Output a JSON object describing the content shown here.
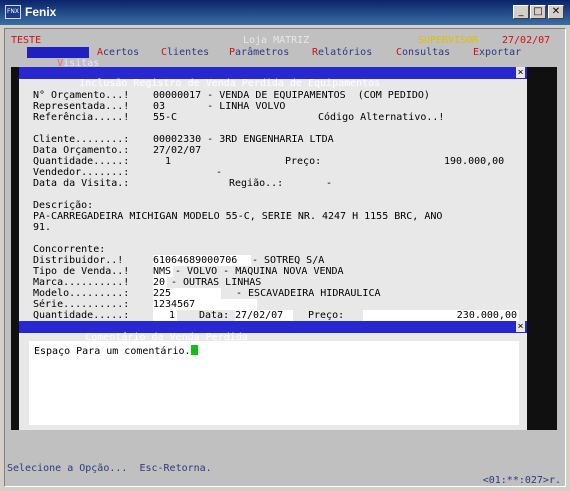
{
  "window": {
    "title": "Fenix",
    "icon": "fenix-logo-icon",
    "min": "_",
    "max": "□",
    "close": "✕"
  },
  "header": {
    "env": "TESTE",
    "store": "Loja MATRIZ",
    "user": "SUPERVISOR",
    "date": "27/02/07"
  },
  "menu": [
    {
      "hk": "V",
      "rest": "isitas",
      "active": true
    },
    {
      "hk": "A",
      "rest": "certos"
    },
    {
      "hk": "C",
      "rest": "lientes"
    },
    {
      "hk": "P",
      "rest": "arâmetros"
    },
    {
      "hk": "R",
      "rest": "elatórios"
    },
    {
      "hk": "C",
      "rest": "onsultas"
    },
    {
      "hk": "E",
      "rest": "xportar"
    }
  ],
  "dialog": {
    "title": "Inclusão Registro de Venda Perdida de Equipamentos",
    "close": "×",
    "orcamento_label": "N° Orçamento...!",
    "orcamento_value": "00000017 - VENDA DE EQUIPAMENTOS  (COM PEDIDO)",
    "representada_label": "Representada...!",
    "representada_value": "03       - LINHA VOLVO",
    "referencia_label": "Referência.....!",
    "referencia_value": "55-C",
    "codigo_alt_label": "Código Alternativo..!",
    "cliente_label": "Cliente........:",
    "cliente_value": "00002330 - 3RD ENGENHARIA LTDA",
    "data_orc_label": "Data Orçamento.:",
    "data_orc_value": "27/02/07",
    "quantidade_label": "Quantidade.....:",
    "quantidade_value": "1",
    "preco_label": "Preço:",
    "preco_value": "190.000,00",
    "vendedor_label": "Vendedor.......:",
    "vendedor_value": "-",
    "data_visita_label": "Data da Visita.:",
    "regiao_label": "Região..:",
    "regiao_value": "-",
    "descricao_label": "Descrição:",
    "descricao_line1": "PA-CARREGADEIRA MICHIGAN MODELO 55-C, SERIE NR. 4247 H 1155 BRC, ANO",
    "descricao_line2": "91.",
    "concorrente_label": "Concorrente:",
    "distribuidor_label": "Distribuidor..!",
    "distribuidor_code": "61064689000706",
    "distribuidor_name": "- SOTREQ S/A",
    "tipo_venda_label": "Tipo de Venda..!",
    "tipo_venda_code": "NMS",
    "tipo_venda_name": "- VOLVO - MAQUINA NOVA VENDA",
    "marca_label": "Marca..........!",
    "marca_code": "20",
    "marca_name": "- OUTRAS LINHAS",
    "modelo_label": "Modelo.........:",
    "modelo_code": "225",
    "modelo_name": "- ESCAVADEIRA HIDRAULICA",
    "serie_label": "Série..........:",
    "serie_value": "1234567",
    "qtd2_label": "Quantidade.....:",
    "qtd2_value": "1",
    "data2_label": "Data:",
    "data2_value": "27/02/07",
    "preco2_label": "Preço:",
    "preco2_value": "230.000,00"
  },
  "comment": {
    "title": "Comentário da Venda Perdida",
    "close": "×",
    "text": "Espaço Para um comentário."
  },
  "status": {
    "hint": "Selecione a Opção...  Esc-Retorna.",
    "position": "<01:**:027>r."
  }
}
